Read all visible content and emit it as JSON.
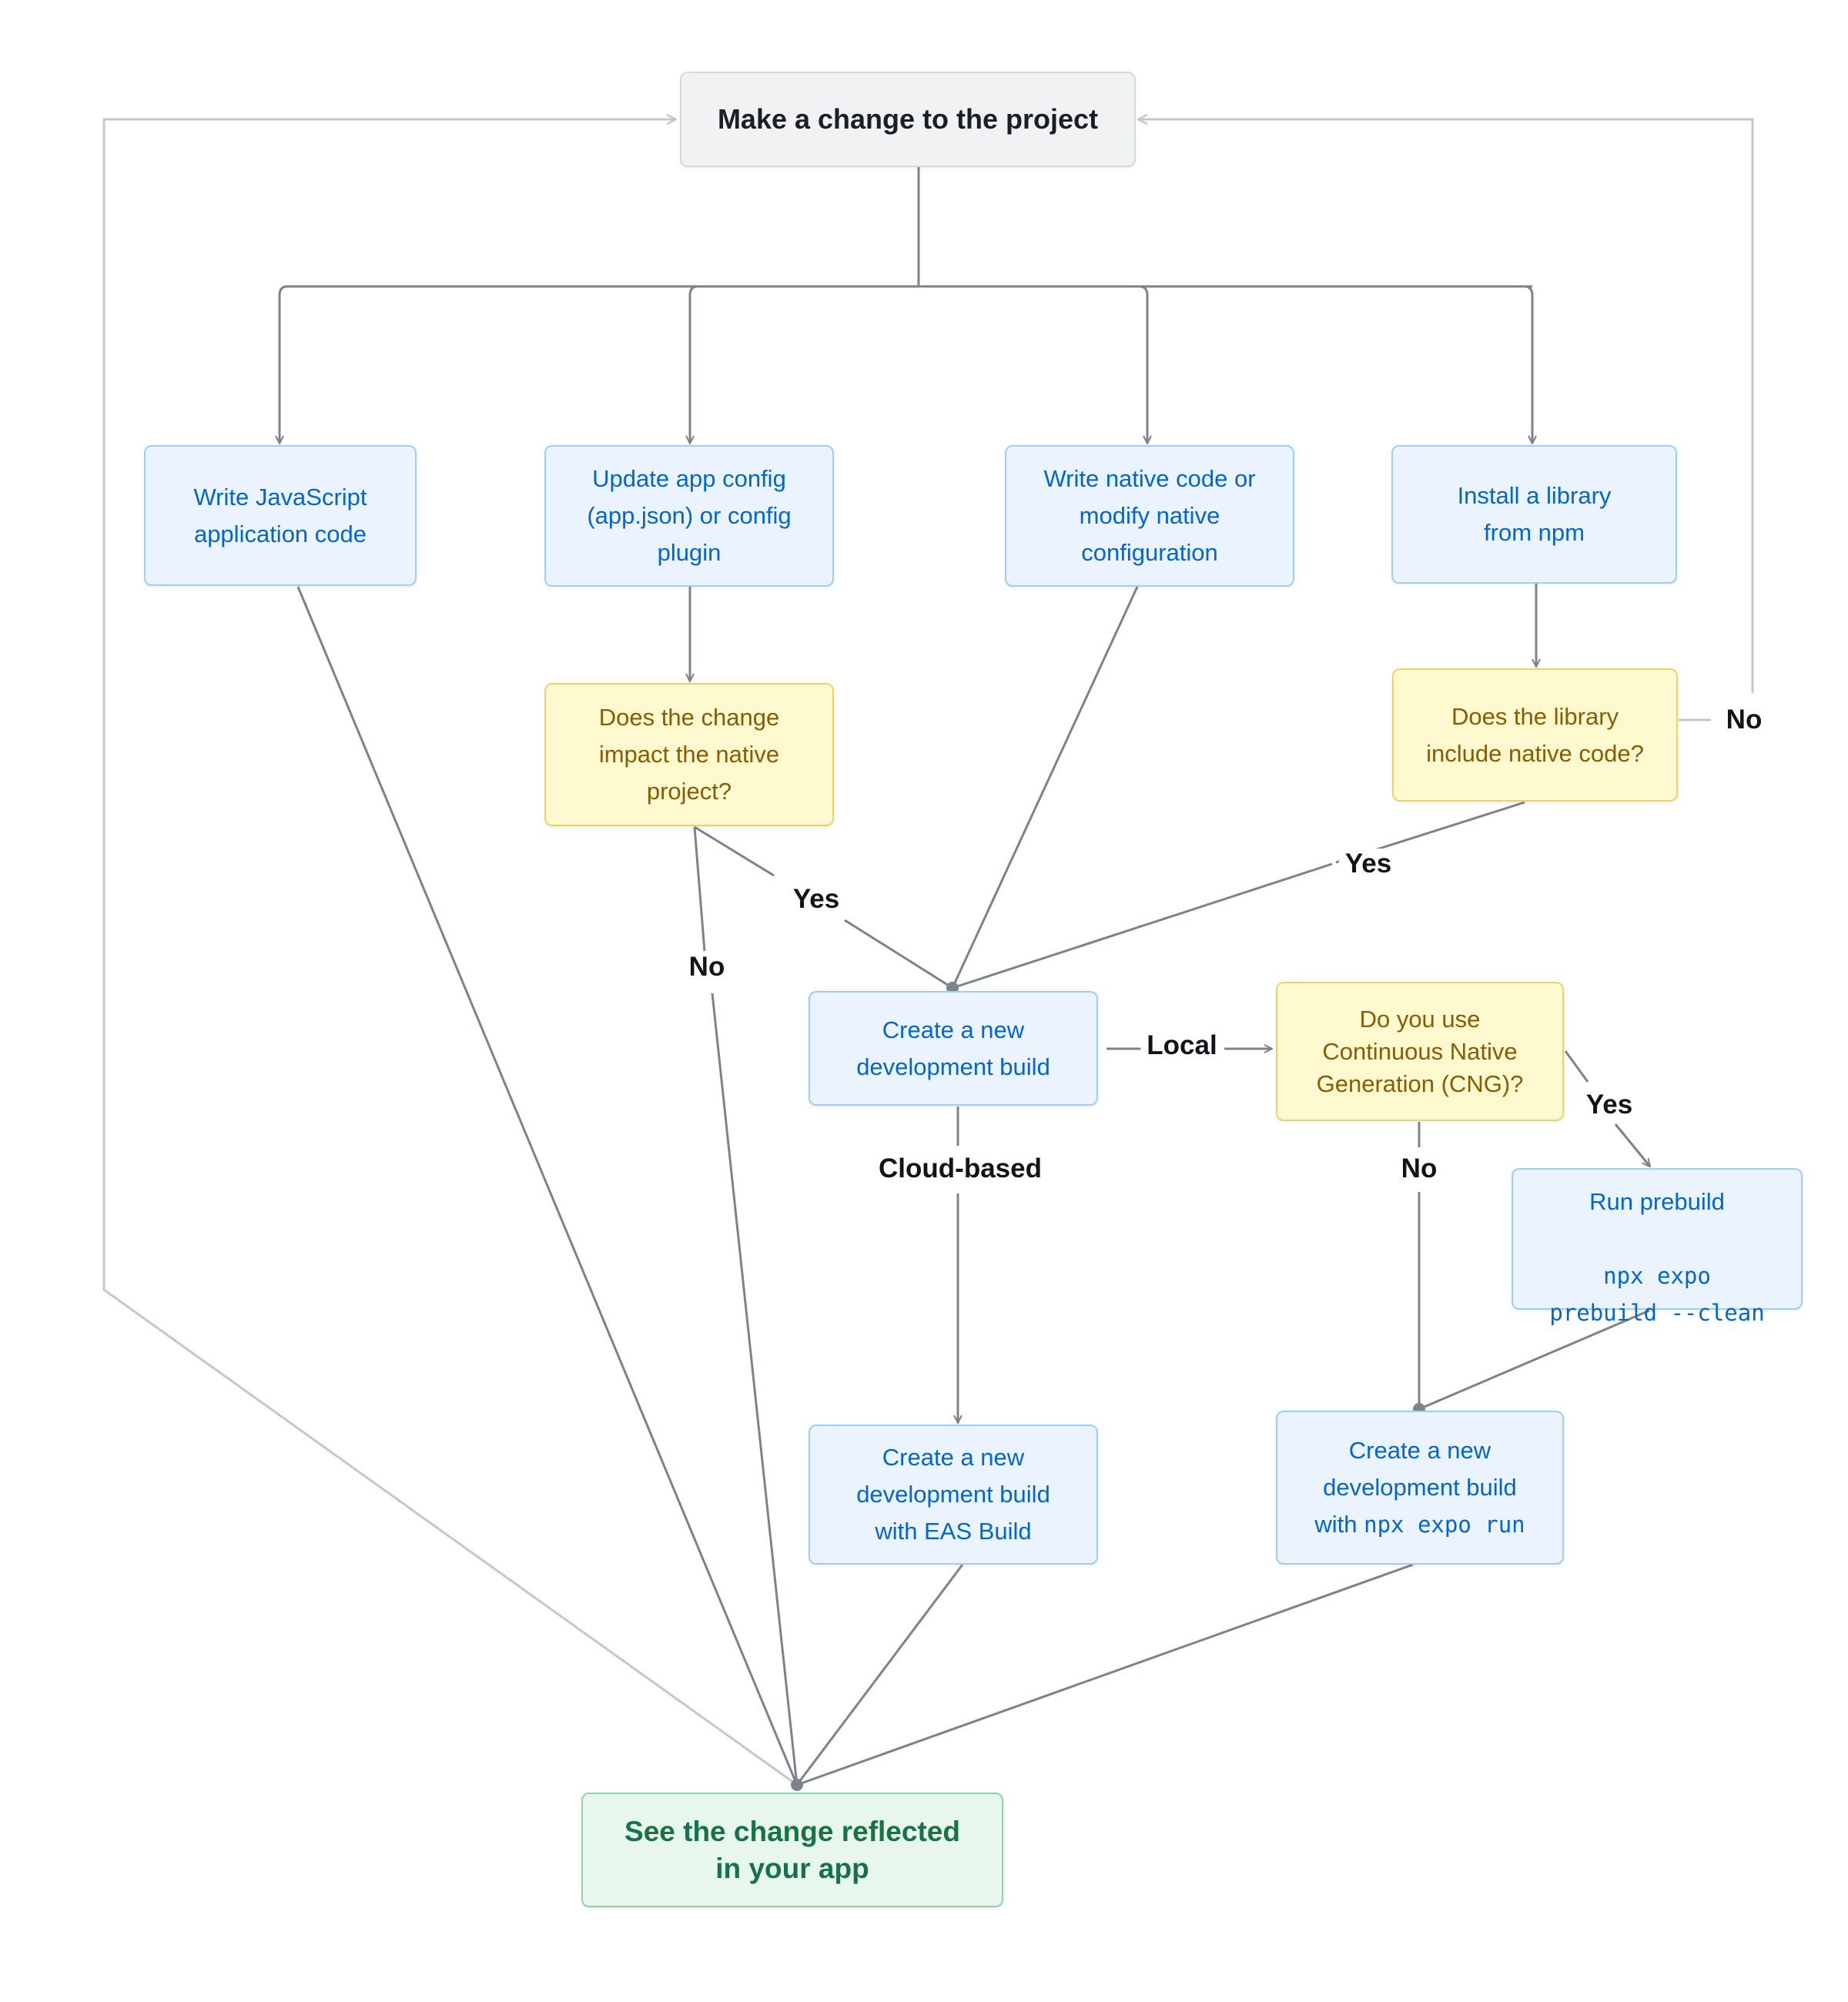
{
  "diagram": {
    "colors": {
      "edge": "#7d838b",
      "loop_edge": "#c3c8cf",
      "step_text": "#0066cc",
      "decision_text": "#8a5c00",
      "end_text": "#177347"
    },
    "nodes": {
      "start": {
        "label": "Make a change to the project",
        "kind": "start"
      },
      "write_js": {
        "label": "Write JavaScript\napplication code",
        "kind": "step"
      },
      "update_config": {
        "label": "Update app config\n(app.json) or config\nplugin",
        "kind": "step"
      },
      "write_native": {
        "label": "Write native code or\nmodify native\nconfiguration",
        "kind": "step"
      },
      "install_lib": {
        "label": "Install a library\nfrom npm",
        "kind": "step"
      },
      "impact_native": {
        "label": "Does the change\nimpact the native\nproject?",
        "kind": "decision"
      },
      "lib_native": {
        "label": "Does the library\ninclude native code?",
        "kind": "decision"
      },
      "create_dev_build": {
        "label": "Create a new\ndevelopment build",
        "kind": "step"
      },
      "use_cng": {
        "label": "Do you use\nContinuous Native\nGeneration (CNG)?",
        "kind": "decision"
      },
      "run_prebuild": {
        "label": "Run prebuild",
        "code": "npx expo\nprebuild --clean",
        "kind": "step"
      },
      "eas_build": {
        "label": "Create a new\ndevelopment build\nwith EAS Build",
        "kind": "step"
      },
      "local_run": {
        "label": "Create a new\ndevelopment build\nwith ",
        "code": "npx expo run",
        "kind": "step"
      },
      "end": {
        "label": "See the change reflected\nin your app",
        "kind": "end"
      }
    },
    "edge_labels": {
      "impact_yes": "Yes",
      "impact_no": "No",
      "lib_yes": "Yes",
      "lib_no": "No",
      "build_local": "Local",
      "build_cloud": "Cloud-based",
      "cng_yes": "Yes",
      "cng_no": "No"
    },
    "edges": [
      {
        "from": "start",
        "to": "write_js"
      },
      {
        "from": "start",
        "to": "update_config"
      },
      {
        "from": "start",
        "to": "write_native"
      },
      {
        "from": "start",
        "to": "install_lib"
      },
      {
        "from": "write_js",
        "to": "end"
      },
      {
        "from": "update_config",
        "to": "impact_native"
      },
      {
        "from": "impact_native",
        "to": "create_dev_build",
        "label": "Yes"
      },
      {
        "from": "impact_native",
        "to": "end",
        "label": "No"
      },
      {
        "from": "write_native",
        "to": "create_dev_build"
      },
      {
        "from": "install_lib",
        "to": "lib_native"
      },
      {
        "from": "lib_native",
        "to": "create_dev_build",
        "label": "Yes"
      },
      {
        "from": "lib_native",
        "to": "start",
        "label": "No"
      },
      {
        "from": "create_dev_build",
        "to": "use_cng",
        "label": "Local"
      },
      {
        "from": "create_dev_build",
        "to": "eas_build",
        "label": "Cloud-based"
      },
      {
        "from": "use_cng",
        "to": "run_prebuild",
        "label": "Yes"
      },
      {
        "from": "use_cng",
        "to": "local_run",
        "label": "No"
      },
      {
        "from": "run_prebuild",
        "to": "local_run"
      },
      {
        "from": "eas_build",
        "to": "end"
      },
      {
        "from": "local_run",
        "to": "end"
      },
      {
        "from": "end",
        "to": "start"
      }
    ]
  }
}
